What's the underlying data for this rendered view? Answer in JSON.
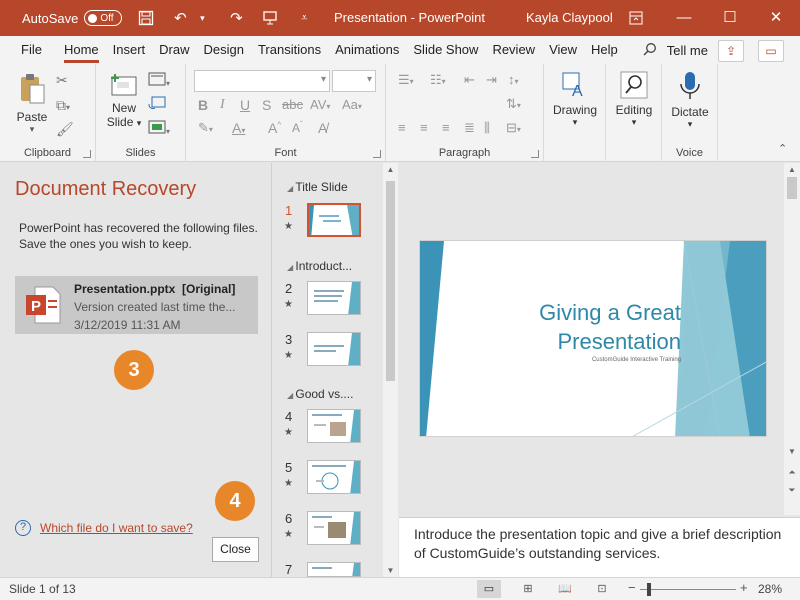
{
  "titlebar": {
    "autosave_label": "AutoSave",
    "autosave_state": "Off",
    "document_title": "Presentation - PowerPoint",
    "user_name": "Kayla Claypool"
  },
  "tabs": [
    "File",
    "Home",
    "Insert",
    "Draw",
    "Design",
    "Transitions",
    "Animations",
    "Slide Show",
    "Review",
    "View",
    "Help"
  ],
  "tell_me": "Tell me",
  "ribbon": {
    "clipboard": {
      "label": "Clipboard",
      "paste": "Paste"
    },
    "slides": {
      "label": "Slides",
      "new_slide_1": "New",
      "new_slide_2": "Slide"
    },
    "font": {
      "label": "Font"
    },
    "paragraph": {
      "label": "Paragraph"
    },
    "drawing": {
      "label": "Drawing"
    },
    "editing": {
      "label": "Editing"
    },
    "voice": {
      "label": "Voice",
      "dictate": "Dictate"
    }
  },
  "recovery": {
    "title": "Document Recovery",
    "message": "PowerPoint has recovered the following files.  Save the ones you wish to keep.",
    "file": {
      "name": "Presentation.pptx  [Original]",
      "description": "Version created last time the...",
      "date": "3/12/2019 11:31 AM"
    },
    "help_link": "Which file do I want to save?",
    "close_label": "Close"
  },
  "callouts": {
    "step3": "3",
    "step4": "4"
  },
  "thumbnails": {
    "sections": [
      "Title Slide",
      "Introduct...",
      "Good vs...."
    ],
    "slide_numbers": [
      "1",
      "2",
      "3",
      "4",
      "5",
      "6",
      "7"
    ]
  },
  "slide": {
    "title_line1": "Giving a Great",
    "title_line2": "Presentation",
    "subtitle": "CustomGuide Interactive Training"
  },
  "notes": "Introduce the presentation topic and give a brief description of CustomGuide’s outstanding services.",
  "status": {
    "slide_info": "Slide 1 of 13",
    "zoom": "28%"
  },
  "colors": {
    "accent": "#b7472a",
    "callout": "#e8862a",
    "slide_title": "#2e89a8"
  }
}
